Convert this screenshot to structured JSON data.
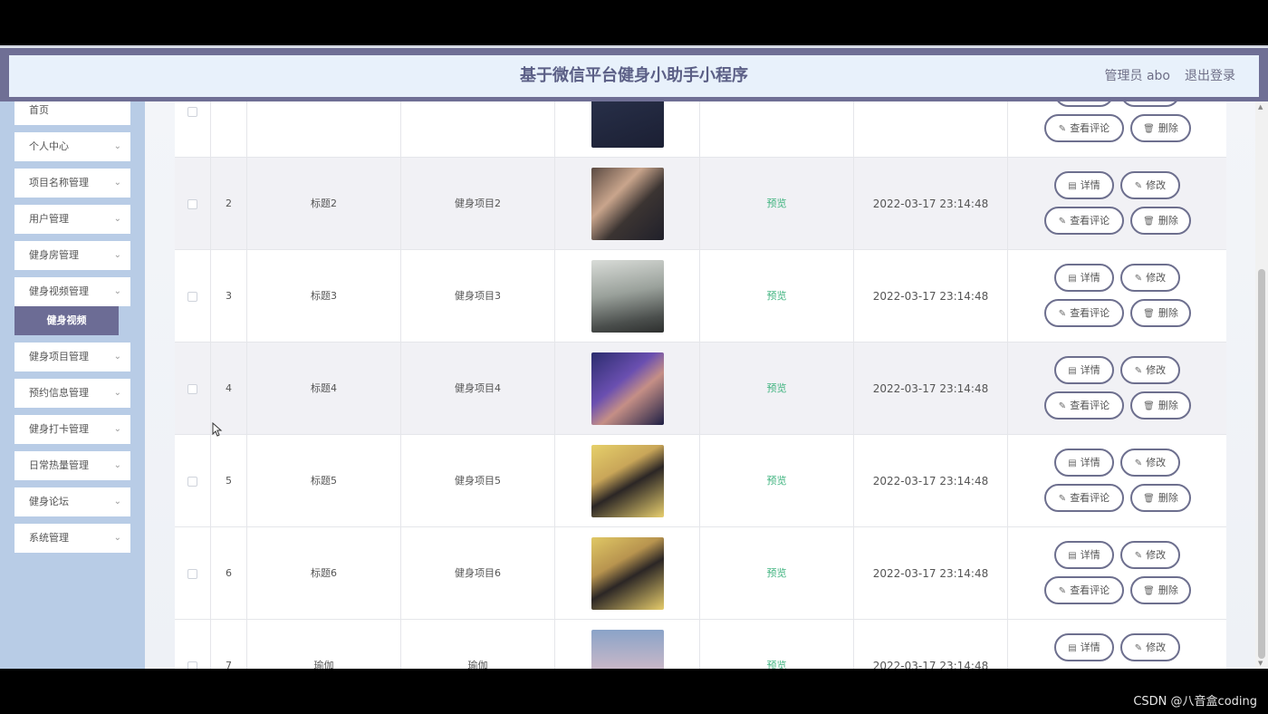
{
  "header": {
    "title": "基于微信平台健身小助手小程序",
    "admin": "管理员 abo",
    "logout": "退出登录"
  },
  "sidebar": {
    "items": [
      {
        "label": "首页"
      },
      {
        "label": "个人中心"
      },
      {
        "label": "项目名称管理"
      },
      {
        "label": "用户管理"
      },
      {
        "label": "健身房管理"
      },
      {
        "label": "健身视频管理"
      },
      {
        "label": "健身项目管理"
      },
      {
        "label": "预约信息管理"
      },
      {
        "label": "健身打卡管理"
      },
      {
        "label": "日常热量管理"
      },
      {
        "label": "健身论坛"
      },
      {
        "label": "系统管理"
      }
    ],
    "active_sub": "健身视频"
  },
  "table": {
    "rows": [
      {
        "index": "",
        "title": "",
        "project": "",
        "preview": "",
        "time": ""
      },
      {
        "index": "2",
        "title": "标题2",
        "project": "健身项目2",
        "preview": "预览",
        "time": "2022-03-17 23:14:48"
      },
      {
        "index": "3",
        "title": "标题3",
        "project": "健身项目3",
        "preview": "预览",
        "time": "2022-03-17 23:14:48"
      },
      {
        "index": "4",
        "title": "标题4",
        "project": "健身项目4",
        "preview": "预览",
        "time": "2022-03-17 23:14:48"
      },
      {
        "index": "5",
        "title": "标题5",
        "project": "健身项目5",
        "preview": "预览",
        "time": "2022-03-17 23:14:48"
      },
      {
        "index": "6",
        "title": "标题6",
        "project": "健身项目6",
        "preview": "预览",
        "time": "2022-03-17 23:14:48"
      },
      {
        "index": "7",
        "title": "瑜伽",
        "project": "瑜伽",
        "preview": "预览",
        "time": "2022-03-17 23:14:48"
      }
    ],
    "buttons": {
      "detail": "详情",
      "edit": "修改",
      "comments": "查看评论",
      "delete": "删除"
    }
  },
  "colors": {
    "header_band": "#6f6f95",
    "header_bg": "#e8f1fb",
    "sidebar_bg": "#b8cce6",
    "active_sub_bg": "#6c6c95",
    "preview_link": "#3fb37f",
    "button_border": "#6d6f8e"
  },
  "icons": {
    "detail": "document-icon",
    "edit": "pencil-icon",
    "comments": "pencil-icon",
    "delete": "trash-icon",
    "menu_expand": "chevron-down-icon"
  },
  "watermark": "CSDN @八音盒coding"
}
